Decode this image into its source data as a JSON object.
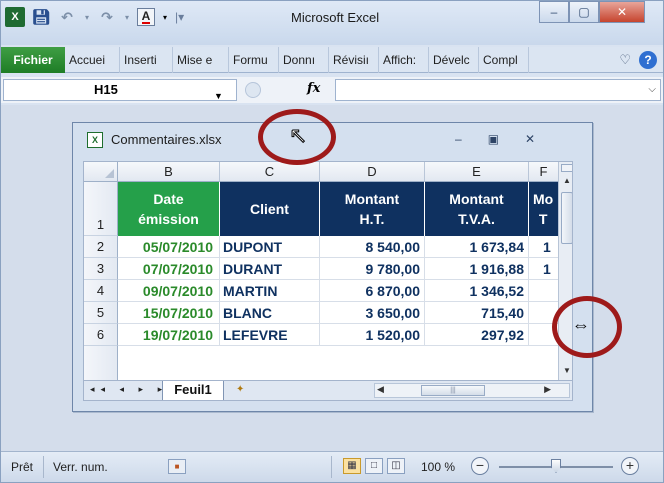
{
  "titlebar": {
    "title": "Microsoft Excel",
    "qat_font_glyph": "A",
    "buttons": {
      "minimize": "–",
      "maximize": "▢",
      "close": "✕"
    }
  },
  "ribbon": {
    "file_tab": "Fichier",
    "tabs": [
      "Accuei",
      "Inserti",
      "Mise e",
      "Formu",
      "Donnı",
      "Révisiı",
      "Affich:",
      "Dévelc",
      "Compl"
    ]
  },
  "formula_bar": {
    "name_box": "H15",
    "fx": "fx",
    "content": ""
  },
  "document": {
    "filename": "Commentaires.xlsx",
    "columns": [
      "B",
      "C",
      "D",
      "E",
      "F"
    ],
    "header_row": {
      "row_number": "1",
      "cells": [
        "Date\némission",
        "Client",
        "Montant\nH.T.",
        "Montant\nT.V.A.",
        "Mo\nT"
      ]
    },
    "rows": [
      {
        "row": "2",
        "date": "05/07/2010",
        "client": "DUPONT",
        "ht": "8 540,00",
        "tva": "1 673,84",
        "f": "1"
      },
      {
        "row": "3",
        "date": "07/07/2010",
        "client": "DURANT",
        "ht": "9 780,00",
        "tva": "1 916,88",
        "f": "1"
      },
      {
        "row": "4",
        "date": "09/07/2010",
        "client": "MARTIN",
        "ht": "6 870,00",
        "tva": "1 346,52",
        "f": ""
      },
      {
        "row": "5",
        "date": "15/07/2010",
        "client": "BLANC",
        "ht": "3 650,00",
        "tva": "715,40",
        "f": ""
      },
      {
        "row": "6",
        "date": "19/07/2010",
        "client": "LEFEVRE",
        "ht": "1 520,00",
        "tva": "297,92",
        "f": ""
      }
    ],
    "sheet_tab": "Feuil1",
    "sheet_nav": "◂◂ ◂ ▸ ▸▸"
  },
  "statusbar": {
    "ready": "Prêt",
    "verr_num": "Verr. num.",
    "zoom": "100 %",
    "zoom_minus": "−",
    "zoom_plus": "+"
  },
  "colors": {
    "header_green": "#25a04a",
    "header_navy": "#0f3160",
    "date_text": "#2a8a2a",
    "annotation_ring": "#9e1a1a"
  }
}
